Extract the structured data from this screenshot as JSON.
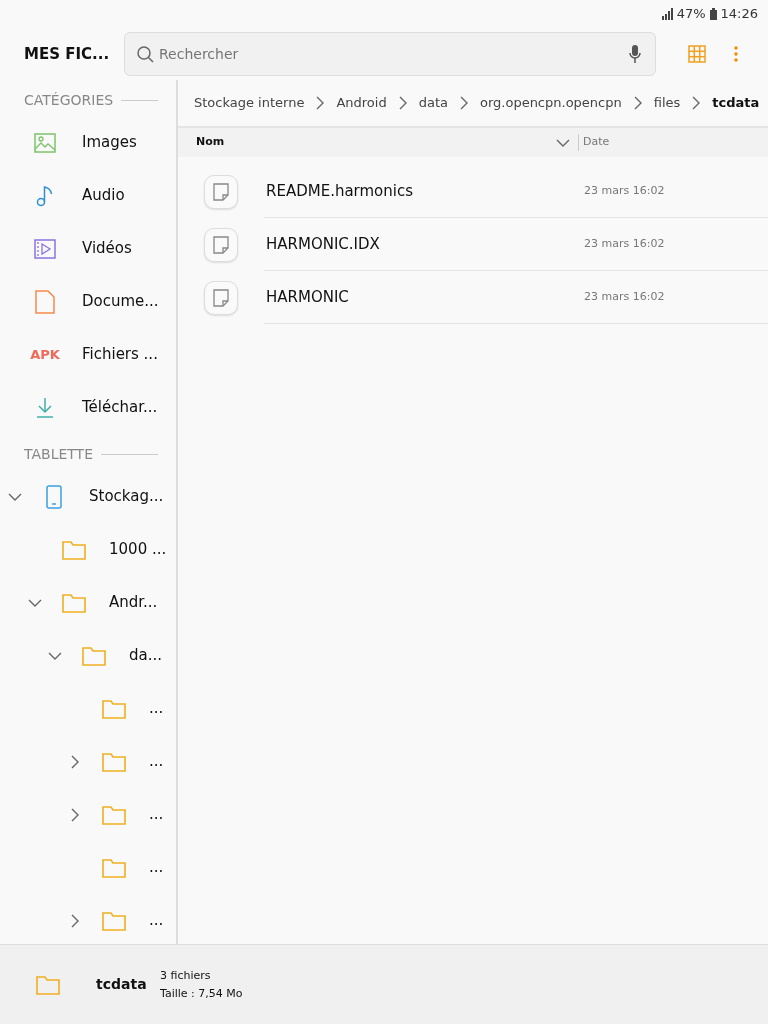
{
  "status_bar": {
    "battery": "47%",
    "time": "14:26"
  },
  "header": {
    "title": "MES FIC...",
    "search": {
      "placeholder": "Rechercher"
    }
  },
  "sidebar": {
    "sections": [
      {
        "title": "CATÉGORIES",
        "items": [
          {
            "kind": "images",
            "label": "Images"
          },
          {
            "kind": "audio",
            "label": "Audio"
          },
          {
            "kind": "videos",
            "label": "Vidéos"
          },
          {
            "kind": "documents",
            "label": "Docume..."
          },
          {
            "kind": "apk",
            "icon_text": "APK",
            "label": "Fichiers ..."
          },
          {
            "kind": "downloads",
            "label": "Téléchar..."
          }
        ]
      },
      {
        "title": "TABLETTE",
        "tree": [
          {
            "kind": "device",
            "label": "Stockag...",
            "has_children": true,
            "expanded": true,
            "children": [
              {
                "kind": "folder",
                "label": "1000 ...",
                "has_children": false,
                "expanded": false
              },
              {
                "kind": "folder",
                "label": "Andr...",
                "has_children": true,
                "expanded": true,
                "children": [
                  {
                    "kind": "folder",
                    "label": "da...",
                    "has_children": true,
                    "expanded": true,
                    "children": [
                      {
                        "kind": "folder",
                        "label": "...",
                        "has_children": false,
                        "expanded": false
                      },
                      {
                        "kind": "folder",
                        "label": "...",
                        "has_children": true,
                        "expanded": false
                      },
                      {
                        "kind": "folder",
                        "label": "...",
                        "has_children": true,
                        "expanded": false
                      },
                      {
                        "kind": "folder",
                        "label": "...",
                        "has_children": false,
                        "expanded": false
                      },
                      {
                        "kind": "folder",
                        "label": "...",
                        "has_children": true,
                        "expanded": false
                      }
                    ]
                  }
                ]
              }
            ]
          }
        ]
      }
    ]
  },
  "breadcrumb": [
    {
      "label": "Stockage interne",
      "selected": false
    },
    {
      "label": "Android",
      "selected": false
    },
    {
      "label": "data",
      "selected": false
    },
    {
      "label": "org.opencpn.opencpn",
      "selected": false
    },
    {
      "label": "files",
      "selected": false
    },
    {
      "label": "tcdata",
      "selected": true
    }
  ],
  "table": {
    "columns": [
      "Nom",
      "Date"
    ],
    "rows": [
      {
        "name": "README.harmonics",
        "date": "23 mars 16:02"
      },
      {
        "name": "HARMONIC.IDX",
        "date": "23 mars 16:02"
      },
      {
        "name": "HARMONIC",
        "date": "23 mars 16:02"
      }
    ]
  },
  "footer": {
    "folder": "tcdata",
    "count": "3 fichiers",
    "size": "Taille : 7,54 Mo"
  }
}
